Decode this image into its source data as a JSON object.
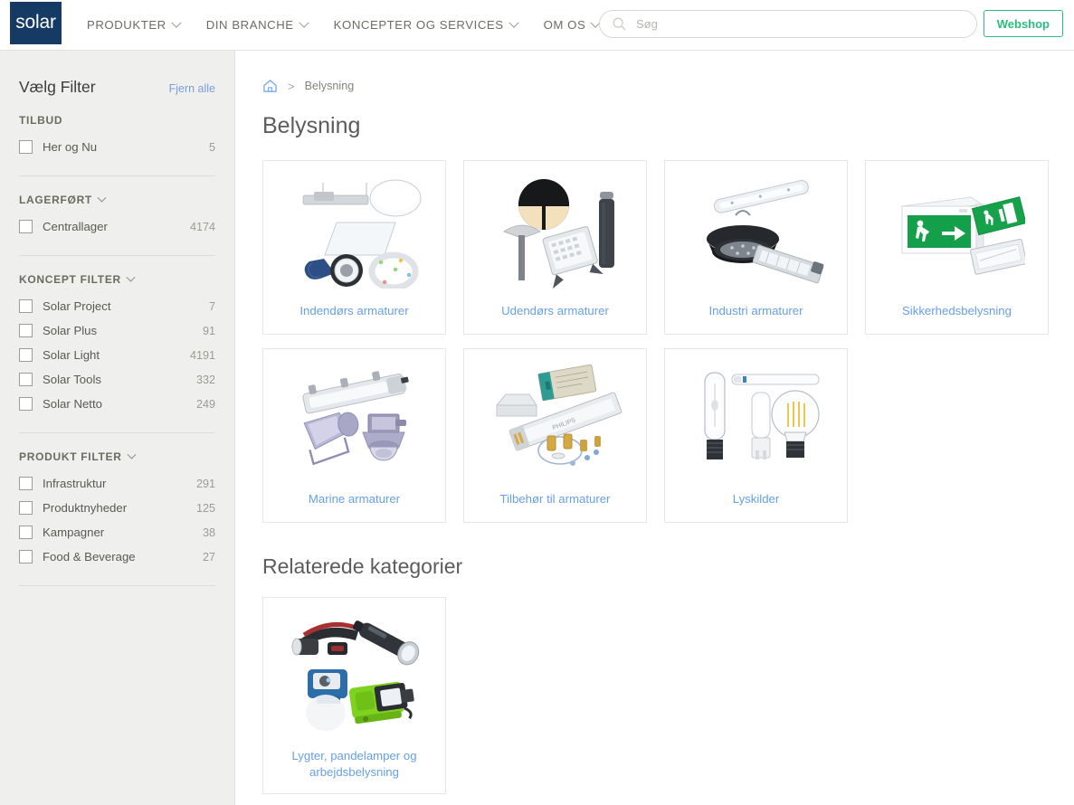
{
  "header": {
    "logo_text": "solar",
    "nav": [
      {
        "label": "PRODUKTER",
        "icon": "chevron-down-icon"
      },
      {
        "label": "DIN BRANCHE",
        "icon": "chevron-down-icon"
      },
      {
        "label": "KONCEPTER OG SERVICES",
        "icon": "chevron-down-icon"
      },
      {
        "label": "OM OS",
        "icon": "chevron-down-icon"
      }
    ],
    "search": {
      "placeholder": "Søg",
      "value": "",
      "icon": "search-icon"
    },
    "webshop_label": "Webshop",
    "accent_green": "#2bbd7e",
    "logo_bg": "#153a63"
  },
  "sidebar": {
    "title": "Vælg Filter",
    "clear_label": "Fjern alle",
    "groups": [
      {
        "heading": "TILBUD",
        "collapsible": false,
        "items": [
          {
            "label": "Her og Nu",
            "count": "5",
            "checked": false
          }
        ]
      },
      {
        "heading": "LAGERFØRT",
        "collapsible": true,
        "items": [
          {
            "label": "Centrallager",
            "count": "4174",
            "checked": false
          }
        ]
      },
      {
        "heading": "KONCEPT FILTER",
        "collapsible": true,
        "items": [
          {
            "label": "Solar Project",
            "count": "7",
            "checked": false
          },
          {
            "label": "Solar Plus",
            "count": "91",
            "checked": false
          },
          {
            "label": "Solar Light",
            "count": "4191",
            "checked": false
          },
          {
            "label": "Solar Tools",
            "count": "332",
            "checked": false
          },
          {
            "label": "Solar Netto",
            "count": "249",
            "checked": false
          }
        ]
      },
      {
        "heading": "PRODUKT FILTER",
        "collapsible": true,
        "items": [
          {
            "label": "Infrastruktur",
            "count": "291",
            "checked": false
          },
          {
            "label": "Produktnyheder",
            "count": "125",
            "checked": false
          },
          {
            "label": "Kampagner",
            "count": "38",
            "checked": false
          },
          {
            "label": "Food & Beverage",
            "count": "27",
            "checked": false
          }
        ]
      }
    ]
  },
  "main": {
    "breadcrumb": {
      "home_icon": "home-icon",
      "separator": ">",
      "current": "Belysning"
    },
    "page_title": "Belysning",
    "categories": [
      {
        "label": "Indendørs armaturer",
        "image": "indoor-luminaires-image"
      },
      {
        "label": "Udendørs armaturer",
        "image": "outdoor-luminaires-image"
      },
      {
        "label": "Industri armaturer",
        "image": "industrial-luminaires-image"
      },
      {
        "label": "Sikkerhedsbelysning",
        "image": "emergency-lighting-image"
      },
      {
        "label": "Marine armaturer",
        "image": "marine-luminaires-image"
      },
      {
        "label": "Tilbehør til armaturer",
        "image": "luminaire-accessories-image"
      },
      {
        "label": "Lyskilder",
        "image": "light-sources-image"
      }
    ],
    "related_title": "Relaterede kategorier",
    "related": [
      {
        "label": "Lygter, pandelamper og arbejdsbelysning",
        "image": "torches-headlamps-image"
      }
    ]
  },
  "colors": {
    "link_blue": "#66a0e8",
    "sidebar_bg": "#efefed",
    "title_gray": "#5c5c5c"
  }
}
